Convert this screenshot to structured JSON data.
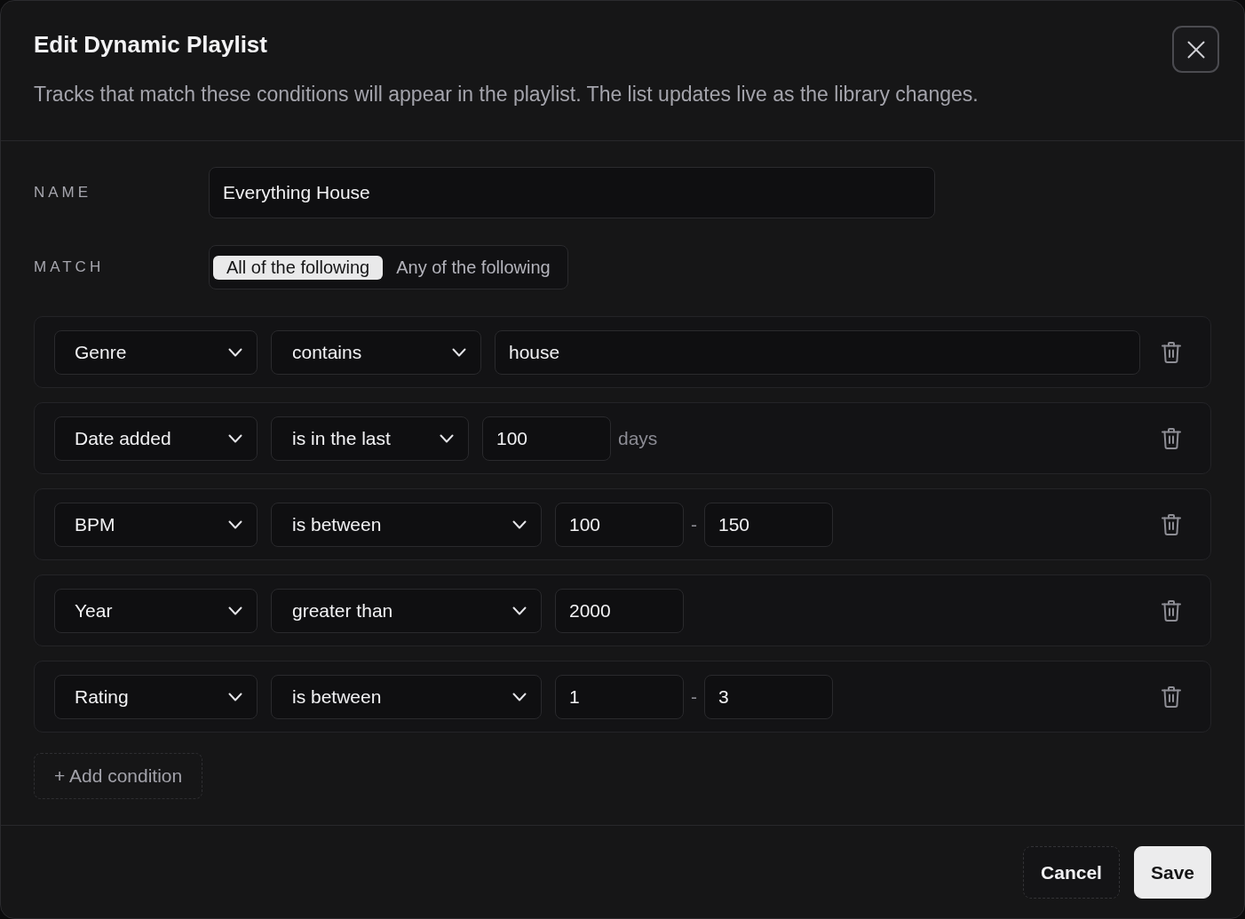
{
  "dialog": {
    "title": "Edit Dynamic Playlist",
    "description": "Tracks that match these conditions will appear in the playlist. The list updates live as the library changes."
  },
  "name_field": {
    "label": "NAME",
    "value": "Everything House"
  },
  "match": {
    "label": "MATCH",
    "options": [
      {
        "label": "All of the following",
        "selected": true
      },
      {
        "label": "Any of the following",
        "selected": false
      }
    ]
  },
  "conditions": [
    {
      "kind": "text",
      "field": "Genre",
      "operator": "contains",
      "value": "house"
    },
    {
      "kind": "unit",
      "field": "Date added",
      "operator": "is in the last",
      "value": "100",
      "unit": "days"
    },
    {
      "kind": "range",
      "field": "BPM",
      "operator": "is between",
      "from": "100",
      "separator": "-",
      "to": "150"
    },
    {
      "kind": "number",
      "field": "Year",
      "operator": "greater than",
      "value": "2000"
    },
    {
      "kind": "range",
      "field": "Rating",
      "operator": "is between",
      "from": "1",
      "separator": "-",
      "to": "3"
    }
  ],
  "add_condition": "+ Add condition",
  "buttons": [
    {
      "kind": "secondary",
      "label": "Cancel"
    },
    {
      "kind": "primary",
      "label": "Save"
    }
  ]
}
